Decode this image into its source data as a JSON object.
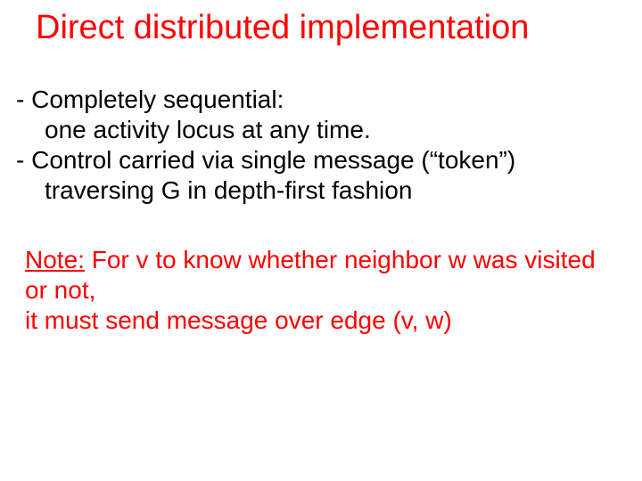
{
  "title": "Direct distributed implementation",
  "bullets": {
    "b1_l1": "- Completely sequential:",
    "b1_l2": "one activity locus at any time.",
    "b2_l1": "- Control carried via single message (“token”)",
    "b2_l2": "traversing G in depth-first fashion"
  },
  "note": {
    "label": "Note:",
    "l1_rest": " For v to know whether neighbor w was visited or not,",
    "l2": "it must send message over edge (v, w)"
  }
}
